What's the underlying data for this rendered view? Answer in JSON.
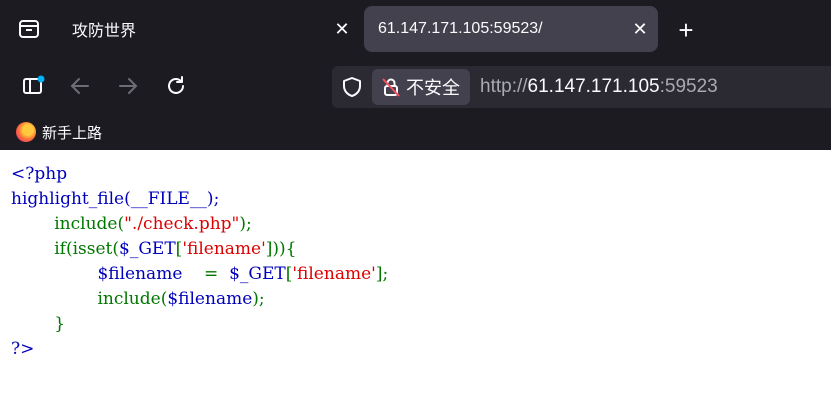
{
  "tabs": [
    {
      "title": "攻防世界",
      "close": "✕",
      "active": false
    },
    {
      "title": "61.147.171.105:59523/",
      "close": "✕",
      "active": true
    }
  ],
  "newtab_label": "+",
  "urlbar": {
    "security_label": "不安全",
    "url_scheme": "http://",
    "url_host": "61.147.171.105",
    "url_port": ":59523"
  },
  "bookmarks": [
    {
      "label": "新手上路",
      "icon": "firefox-icon"
    }
  ],
  "colors": {
    "php_default": "#0000bb",
    "php_keyword": "#007700",
    "php_string": "#dd0000"
  },
  "code": {
    "l1": "<?php",
    "l2": "highlight_file(__FILE__);",
    "l3a": "        include(",
    "l3s": "\"./check.php\"",
    "l3b": ");",
    "l4a": "        if(isset(",
    "l4v": "$_GET",
    "l4b": "[",
    "l4s": "'filename'",
    "l4c": "])){",
    "l5v": "                $filename    ",
    "l5b": "=  ",
    "l5v2": "$_GET",
    "l5c": "[",
    "l5s": "'filename'",
    "l5d": "];",
    "l6a": "                include(",
    "l6v": "$filename",
    "l6b": ");",
    "l7": "        }",
    "l8": "?>"
  }
}
